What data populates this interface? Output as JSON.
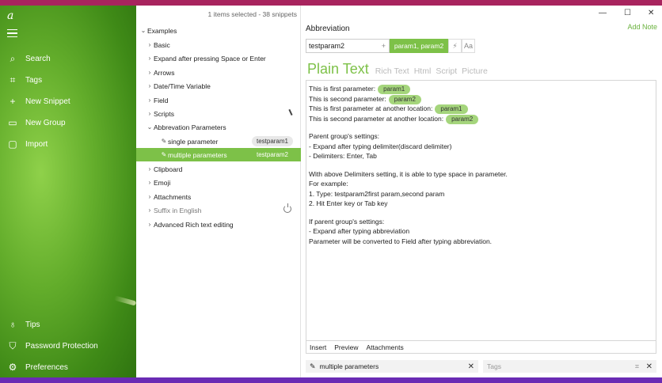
{
  "sidebar": {
    "logo": "a",
    "items": [
      {
        "label": "Search",
        "icon": "⌕"
      },
      {
        "label": "Tags",
        "icon": "⌗"
      },
      {
        "label": "New Snippet",
        "icon": "+"
      },
      {
        "label": "New Group",
        "icon": "▭"
      },
      {
        "label": "Import",
        "icon": "▢"
      }
    ],
    "bottom_items": [
      {
        "label": "Tips",
        "icon": "♁"
      },
      {
        "label": "Password Protection",
        "icon": "⛉"
      },
      {
        "label": "Preferences",
        "icon": "⚙"
      }
    ]
  },
  "tree": {
    "status": "1 items selected - 38 snippets",
    "root": "Examples",
    "groups": [
      {
        "label": "Basic"
      },
      {
        "label": "Expand after pressing Space or Enter"
      },
      {
        "label": "Arrows"
      },
      {
        "label": "Date/Time Variable"
      },
      {
        "label": "Field"
      },
      {
        "label": "Scripts"
      },
      {
        "label": "Abbrevation Parameters"
      }
    ],
    "children": [
      {
        "label": "single parameter",
        "tag": "testparam1"
      },
      {
        "label": "multiple parameters",
        "tag": "testparam2"
      }
    ],
    "groups_after": [
      {
        "label": "Clipboard"
      },
      {
        "label": "Emoji"
      },
      {
        "label": "Attachments"
      },
      {
        "label": "Suffix in English"
      },
      {
        "label": "Advanced Rich text editing"
      }
    ]
  },
  "window": {
    "minimize": "—",
    "maximize": "☐",
    "close": "✕"
  },
  "editor": {
    "title": "Abbreviation",
    "add_note": "Add Note",
    "abbreviation": "testparam2",
    "abbr_plus": "+",
    "params": "param1, param2",
    "opt1": "⚡",
    "opt2": "Aa",
    "tabs": [
      "Plain Text",
      "Rich Text",
      "Html",
      "Script",
      "Picture"
    ],
    "lines": [
      {
        "text": "This is first parameter:",
        "pill": "param1"
      },
      {
        "text": "This is second parameter:",
        "pill": "param2"
      },
      {
        "text": "This is first parameter at another location:",
        "pill": "param1"
      },
      {
        "text": "This is second parameter at another location:",
        "pill": "param2"
      }
    ],
    "para1": [
      "Parent group's settings:",
      "- Expand after typing delimiter(discard delimiter)",
      "- Delimiters: Enter, Tab"
    ],
    "para2": [
      "With above Delimiters setting, it is able to type space in parameter.",
      "For example:",
      "1. Type: testparam2first param,second param",
      "2. Hit Enter key or Tab key"
    ],
    "para3": [
      "If parent group's settings:",
      "- Expand after typing abbreviation",
      "Parameter will be converted to Field after typing abbreviation."
    ],
    "bottom_tabs": [
      "Insert",
      "Preview",
      "Attachments"
    ],
    "snippet_name": "multiple parameters",
    "tags_placeholder": "Tags"
  }
}
